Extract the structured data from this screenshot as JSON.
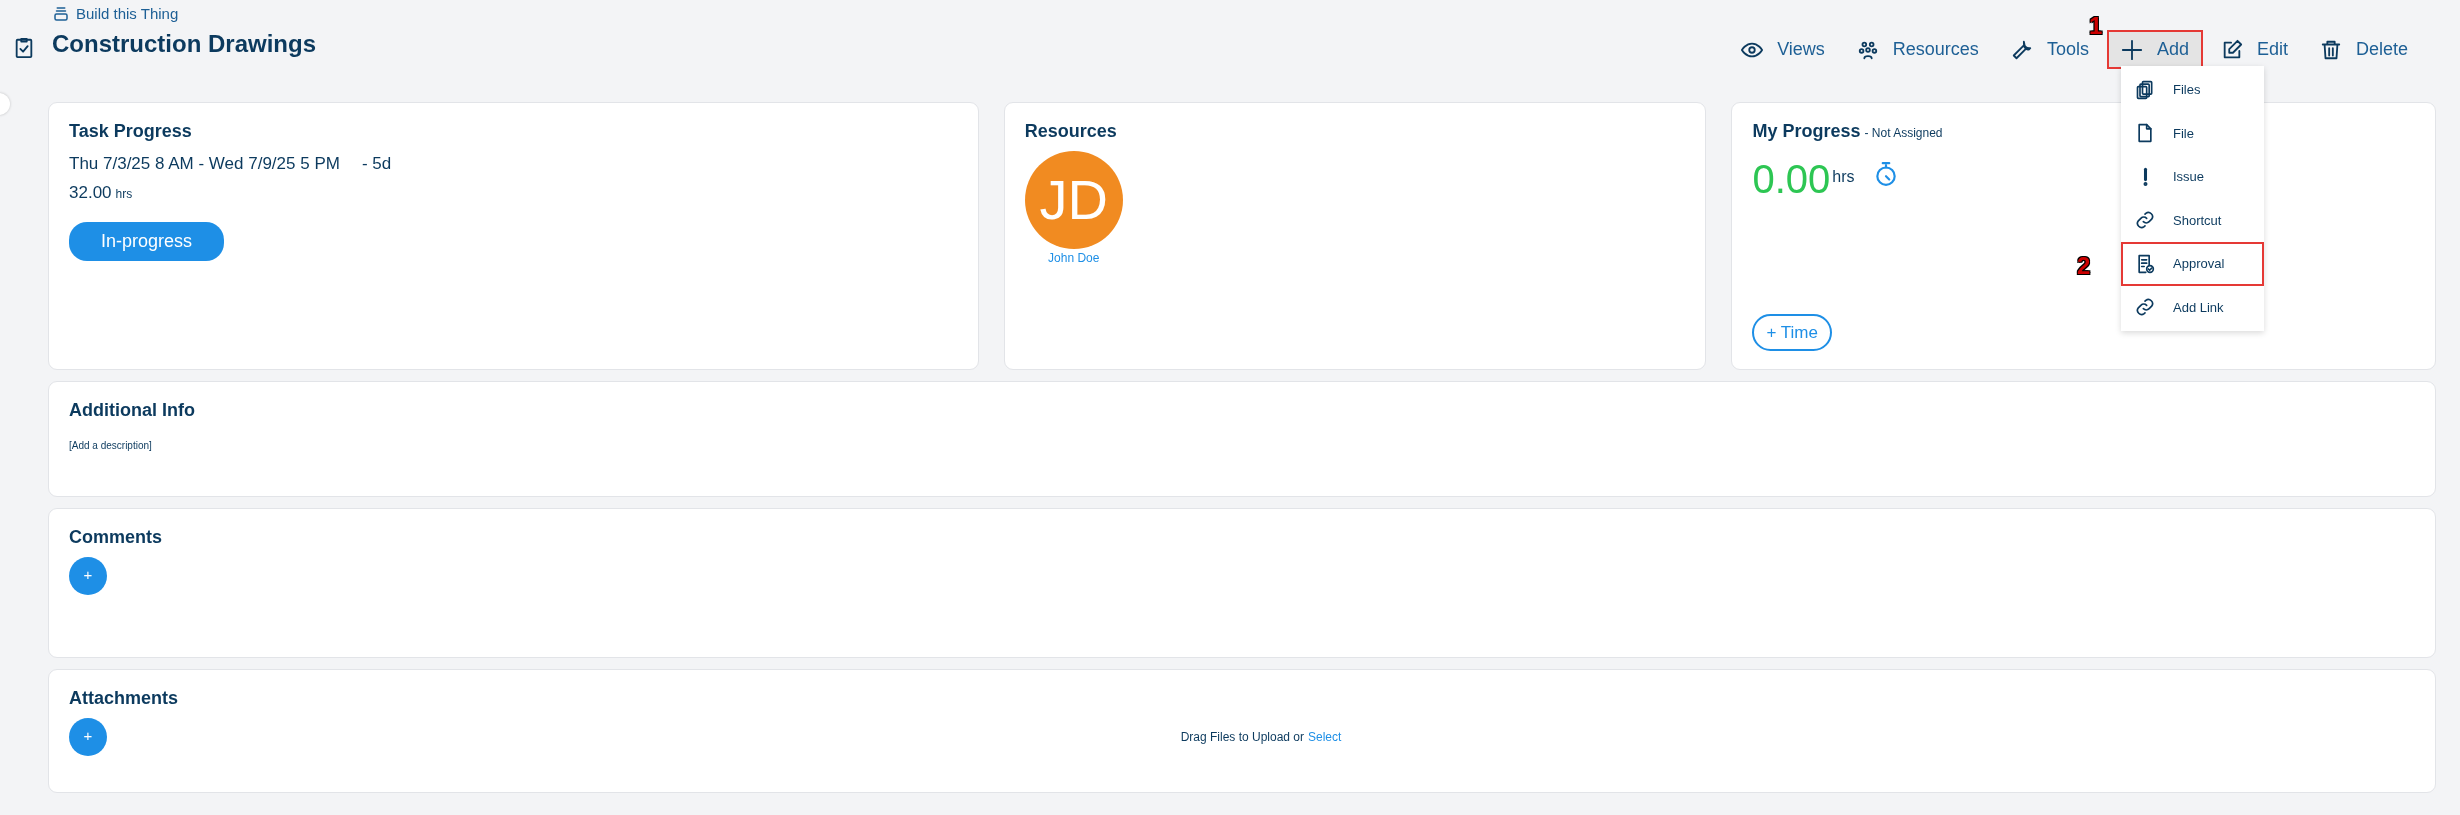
{
  "breadcrumb": "Build this Thing",
  "title": "Construction Drawings",
  "toolbar": [
    {
      "kind": "views",
      "label": "Views",
      "highlighted": false
    },
    {
      "kind": "resources",
      "label": "Resources",
      "highlighted": false
    },
    {
      "kind": "tools",
      "label": "Tools",
      "highlighted": false
    },
    {
      "kind": "add",
      "label": "Add",
      "highlighted": true,
      "callout": "1"
    },
    {
      "kind": "edit",
      "label": "Edit",
      "highlighted": false
    },
    {
      "kind": "delete",
      "label": "Delete",
      "highlighted": false
    }
  ],
  "add_menu": [
    {
      "kind": "files",
      "label": "Files",
      "highlighted": false
    },
    {
      "kind": "file",
      "label": "File",
      "highlighted": false
    },
    {
      "kind": "issue",
      "label": "Issue",
      "highlighted": false
    },
    {
      "kind": "shortcut",
      "label": "Shortcut",
      "highlighted": false
    },
    {
      "kind": "approval",
      "label": "Approval",
      "highlighted": true,
      "callout": "2"
    },
    {
      "kind": "link",
      "label": "Add Link",
      "highlighted": false
    }
  ],
  "task_progress": {
    "title": "Task Progress",
    "dates": "Thu 7/3/25 8 AM - Wed 7/9/25 5 PM",
    "duration": "- 5d",
    "hours": "32.00",
    "hours_unit": "hrs",
    "status": "In-progress"
  },
  "resources": {
    "title": "Resources",
    "people": [
      {
        "initials": "JD",
        "name": "John Doe",
        "color": "#f18b21"
      }
    ]
  },
  "my_progress": {
    "title": "My Progress",
    "subtitle": "- Not Assigned",
    "hours": "0.00",
    "hours_unit": "hrs",
    "button": "+ Time"
  },
  "additional_info": {
    "title": "Additional Info",
    "description": "[Add a description]"
  },
  "comments": {
    "title": "Comments",
    "add_button": "+"
  },
  "attachments": {
    "title": "Attachments",
    "add_button": "+",
    "drop_text": "Drag Files to Upload or",
    "select_link": "Select"
  }
}
